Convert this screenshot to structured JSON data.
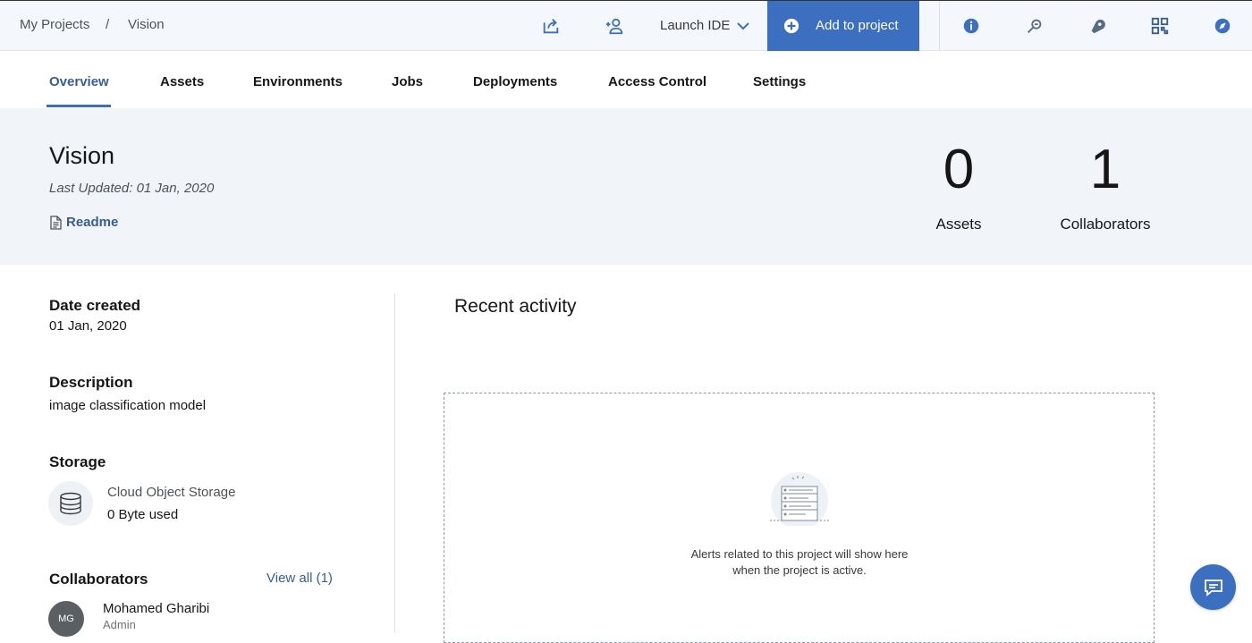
{
  "breadcrumb": {
    "root": "My Projects",
    "separator": "/",
    "current": "Vision"
  },
  "toolbar": {
    "launch_label": "Launch IDE",
    "add_label": "Add to project",
    "icons": [
      "export-icon",
      "add-user-icon",
      "info-icon",
      "feedback-icon",
      "notification-icon",
      "app-switcher-icon",
      "explore-icon"
    ]
  },
  "tabs": [
    {
      "label": "Overview",
      "active": true
    },
    {
      "label": "Assets"
    },
    {
      "label": "Environments"
    },
    {
      "label": "Jobs"
    },
    {
      "label": "Deployments"
    },
    {
      "label": "Access Control"
    },
    {
      "label": "Settings"
    }
  ],
  "project": {
    "title": "Vision",
    "last_updated": "Last Updated:  01 Jan, 2020",
    "readme_label": "Readme"
  },
  "stats": {
    "assets_count": "0",
    "assets_label": "Assets",
    "collab_count": "1",
    "collab_label": "Collaborators"
  },
  "details": {
    "date_created_label": "Date created",
    "date_created": "01 Jan, 2020",
    "description_label": "Description",
    "description": "image classification model",
    "storage_label": "Storage",
    "storage_name": "Cloud Object Storage",
    "storage_used": "0 Byte used",
    "collaborators_label": "Collaborators",
    "view_all": "View all (1)",
    "collaborator": {
      "initials": "MG",
      "name": "Mohamed Gharibi",
      "role": "Admin"
    }
  },
  "activity": {
    "title": "Recent activity",
    "empty_line1": "Alerts related to this project will show here",
    "empty_line2": "when the project is active."
  },
  "colors": {
    "accent": "#3d6fc1",
    "hero_bg": "#f1f4f8",
    "link": "#3a5d8f"
  }
}
